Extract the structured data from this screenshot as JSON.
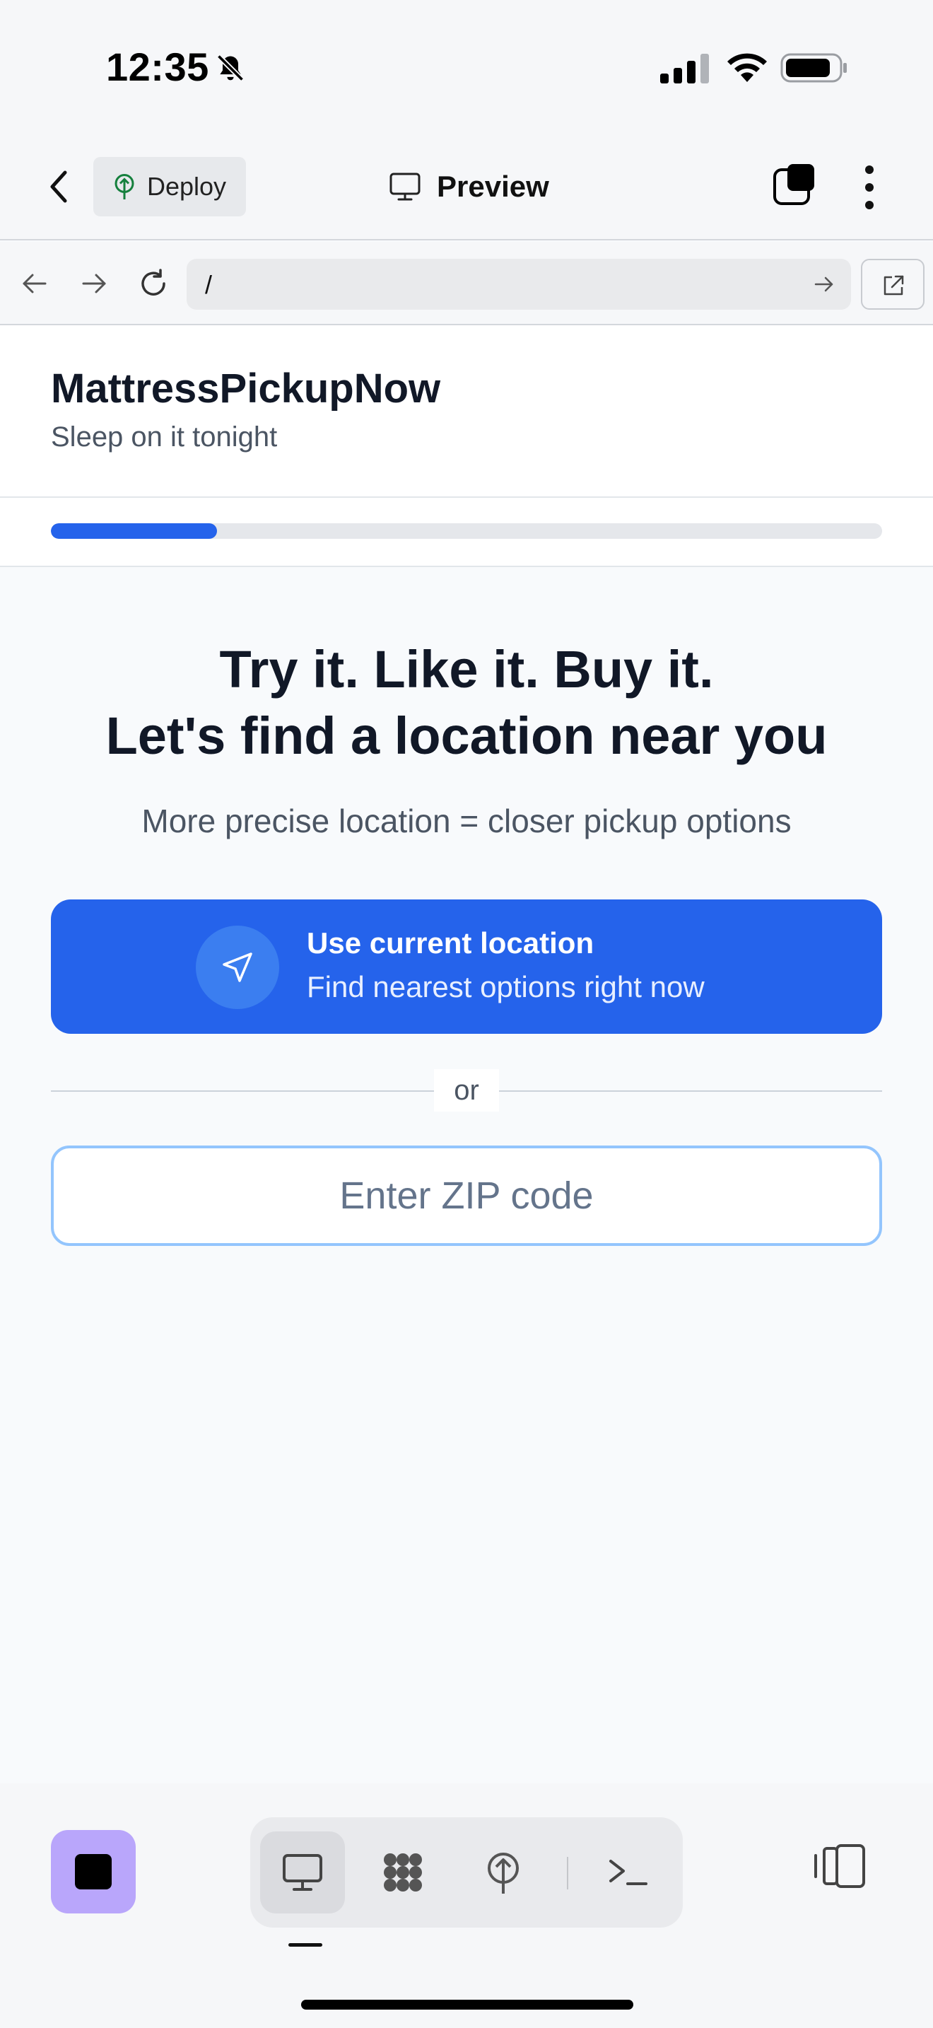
{
  "status_bar": {
    "time": "12:35",
    "icons": [
      "bell-slash-icon",
      "cellular-signal-icon",
      "wifi-icon",
      "battery-icon"
    ]
  },
  "app_header": {
    "back_icon": "chevron-left-icon",
    "deploy_label": "Deploy",
    "deploy_icon": "deploy-tree-icon",
    "preview_label": "Preview",
    "preview_icon": "monitor-icon",
    "tabs_icon": "tabs-icon",
    "more_icon": "more-vertical-icon"
  },
  "browser": {
    "url": "/",
    "icons": [
      "arrow-left-icon",
      "arrow-right-icon",
      "reload-icon",
      "go-arrow-icon",
      "external-link-icon"
    ]
  },
  "site": {
    "brand": "MattressPickupNow",
    "tagline": "Sleep on it tonight",
    "progress": 0.2,
    "headline_line1": "Try it. Like it. Buy it.",
    "headline_line2": "Let's find a location near you",
    "subline": "More precise location = closer pickup options",
    "location_button": {
      "title": "Use current location",
      "subtitle": "Find nearest options right now",
      "icon": "navigation-arrow-icon"
    },
    "divider_text": "or",
    "zip_placeholder": "Enter ZIP code",
    "zip_value": ""
  },
  "bottom_toolbar": {
    "stop_icon": "stop-icon",
    "segments": [
      {
        "name": "preview",
        "icon": "monitor-icon",
        "active": true
      },
      {
        "name": "workflow",
        "icon": "workflow-icon",
        "active": false
      },
      {
        "name": "deploy",
        "icon": "deploy-tree-icon",
        "active": false
      },
      {
        "name": "console",
        "icon": "terminal-icon",
        "active": false
      }
    ],
    "panel_icon": "panel-toggle-icon"
  },
  "colors": {
    "accent": "#2563eb",
    "stop_button": "#b9a6fb",
    "input_focus": "#93c5fd"
  }
}
